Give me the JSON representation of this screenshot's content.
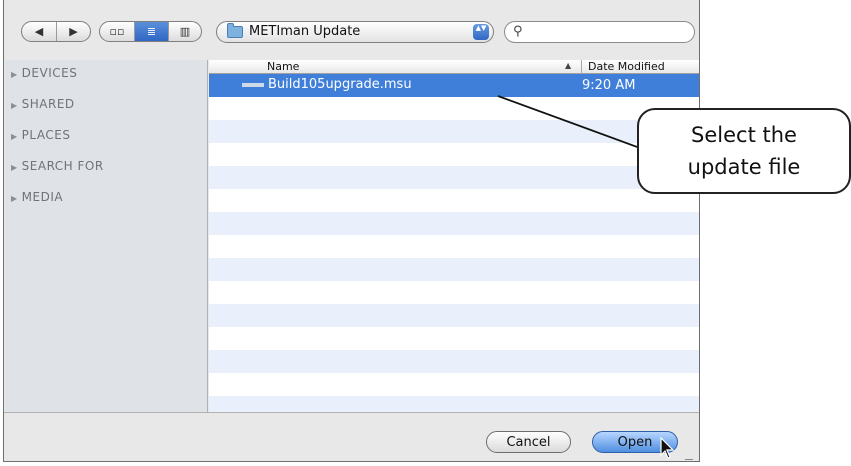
{
  "toolbar": {
    "back_glyph": "◀",
    "forward_glyph": "▶",
    "view_icon_glyph": "▫▫",
    "view_list_glyph": "≣",
    "view_column_glyph": "▥",
    "location": "METIman Update",
    "popup_arrows": "▲▼",
    "search_glyph": "⚲",
    "search_value": ""
  },
  "sidebar": {
    "items": [
      {
        "label": "DEVICES"
      },
      {
        "label": "SHARED"
      },
      {
        "label": "PLACES"
      },
      {
        "label": "SEARCH FOR"
      },
      {
        "label": "MEDIA"
      }
    ],
    "disclosure_glyph": "▶"
  },
  "list": {
    "columns": {
      "name": "Name",
      "date": "Date Modified",
      "sort_glyph": "▲"
    },
    "rows": [
      {
        "name": "Build105upgrade.msu",
        "date": "9:20 AM",
        "selected": true
      }
    ]
  },
  "buttons": {
    "cancel": "Cancel",
    "open": "Open"
  },
  "callout": {
    "line1": "Select the",
    "line2": "update file"
  },
  "colors": {
    "selection": "#3f7fd9",
    "alt_row": "#eaf0fb",
    "sidebar": "#dfe3e8"
  }
}
